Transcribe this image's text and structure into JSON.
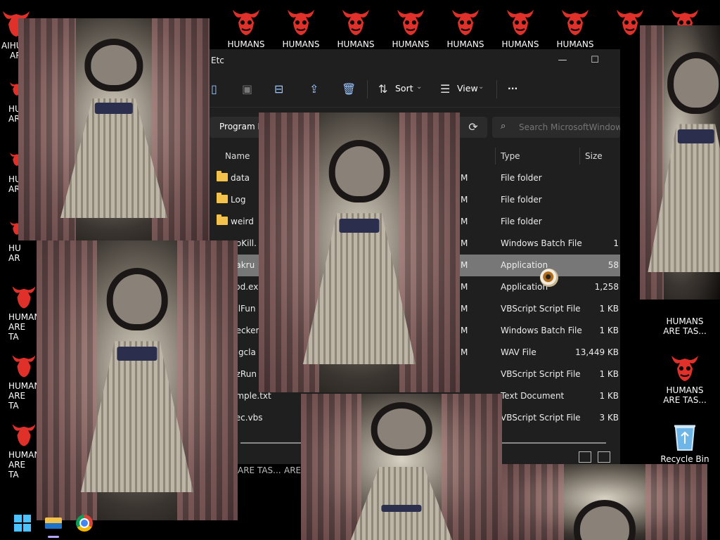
{
  "desktop": {
    "top_row_label": "HUMANS",
    "icon_label": "HUMANS\nARE TAS...",
    "recycle_bin_label": "Recycle Bin",
    "partial_labels": [
      "AIHU",
      "AR",
      "HU",
      "AR",
      "HU",
      "AR",
      "HU",
      "AR",
      "HUMAN",
      "ARE TA",
      "HUMAN",
      "ARE TA",
      "HUMAN",
      "ARE TA",
      "ARE TAS...",
      "ARE"
    ]
  },
  "explorer": {
    "title_fragment": "Etc",
    "toolbar": {
      "sort_label": "Sort",
      "view_label": "View",
      "more_label": "···"
    },
    "address_crumb": "Program F",
    "search_placeholder": "Search MicrosoftWindowsS",
    "columns": {
      "name": "Name",
      "type": "Type",
      "size": "Size"
    },
    "rows": [
      {
        "name": "data",
        "date_suffix": "M",
        "type": "File folder",
        "size": "",
        "folder": true
      },
      {
        "name": "Log",
        "date_suffix": "M",
        "type": "File folder",
        "size": "",
        "folder": true
      },
      {
        "name": "weird",
        "date_suffix": "M",
        "type": "File folder",
        "size": "",
        "folder": true
      },
      {
        "name": "ppKill.",
        "date_suffix": "M",
        "type": "Windows Batch File",
        "size": "1",
        "folder": false
      },
      {
        "name": "eakru",
        "date_suffix": "M",
        "type": "Application",
        "size": "58",
        "folder": false,
        "selected": true
      },
      {
        "name": "sod.ex",
        "date_suffix": "M",
        "type": "Application",
        "size": "1,258",
        "folder": false
      },
      {
        "name": "allFun",
        "date_suffix": "M",
        "type": "VBScript Script File",
        "size": "1 KB",
        "folder": false
      },
      {
        "name": "hecker",
        "date_suffix": "M",
        "type": "Windows Batch File",
        "size": "1 KB",
        "folder": false
      },
      {
        "name": "ingcla",
        "date_suffix": "M",
        "type": "WAV File",
        "size": "13,449 KB",
        "folder": false
      },
      {
        "name": "gzRun",
        "date_suffix": "",
        "type": "VBScript Script File",
        "size": "1 KB",
        "folder": false
      },
      {
        "name": "ample.txt",
        "date_suffix": "",
        "type": "Text Document",
        "size": "1 KB",
        "folder": false
      },
      {
        "name": "xec.vbs",
        "date_suffix": "",
        "type": "VBScript Script File",
        "size": "3 KB",
        "folder": false
      }
    ]
  },
  "colors": {
    "window_bg": "#1f1f1f",
    "selected_row": "#777777",
    "folder": "#f2c24b",
    "accent": "#9cc7ff",
    "demon_red": "#e0302a"
  },
  "icons": [
    "demon-face-icon",
    "recycle-bin-icon",
    "folder-icon",
    "windows-start-icon",
    "file-explorer-icon",
    "chrome-icon",
    "eyeball-cursor-icon"
  ]
}
